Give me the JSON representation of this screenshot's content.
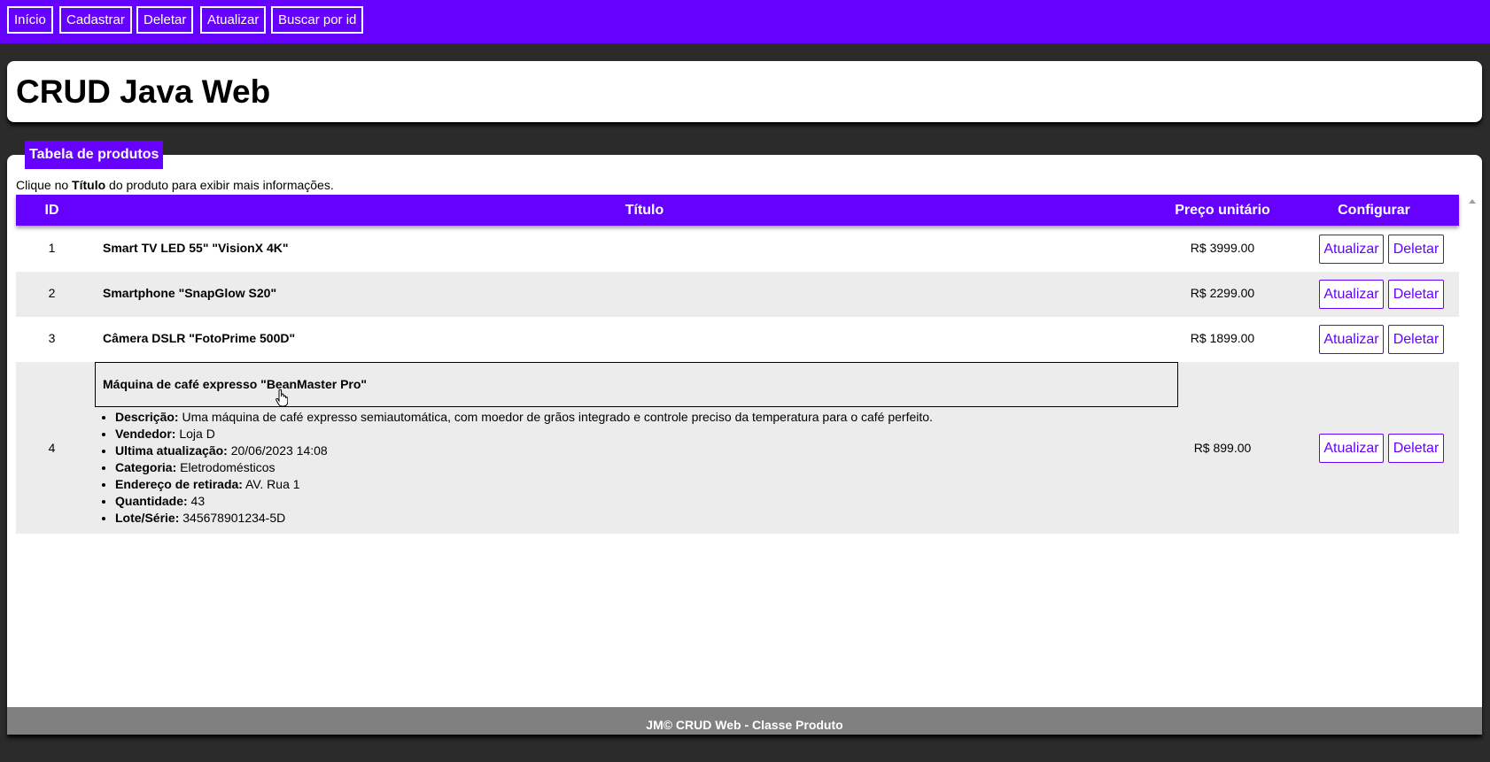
{
  "nav": {
    "items": [
      "Início",
      "Cadastrar",
      "Deletar",
      "Atualizar",
      "Buscar por id"
    ]
  },
  "header": {
    "title": "CRUD Java Web"
  },
  "section": {
    "tag": "Tabela de produtos",
    "hint_prefix": "Clique no ",
    "hint_bold": "Título",
    "hint_suffix": " do produto para exibir mais informações."
  },
  "table": {
    "columns": [
      "ID",
      "Título",
      "Preço unitário",
      "Configurar"
    ],
    "update_label": "Atualizar",
    "delete_label": "Deletar",
    "rows": [
      {
        "id": "1",
        "title": "Smart TV LED 55\" \"VisionX 4K\"",
        "price": "R$ 3999.00"
      },
      {
        "id": "2",
        "title": "Smartphone \"SnapGlow S20\"",
        "price": "R$ 2299.00"
      },
      {
        "id": "3",
        "title": "Câmera DSLR \"FotoPrime 500D\"",
        "price": "R$ 1899.00"
      },
      {
        "id": "4",
        "title": "Máquina de café expresso \"BeanMaster Pro\"",
        "price": "R$ 899.00",
        "details": [
          {
            "label": "Descrição:",
            "value": " Uma máquina de café expresso semiautomática, com moedor de grãos integrado e controle preciso da temperatura para o café perfeito."
          },
          {
            "label": "Vendedor:",
            "value": " Loja D"
          },
          {
            "label": "Ultima atualização:",
            "value": " 20/06/2023 14:08"
          },
          {
            "label": "Categoria:",
            "value": " Eletrodomésticos"
          },
          {
            "label": "Endereço de retirada:",
            "value": " AV. Rua 1"
          },
          {
            "label": "Quantidade:",
            "value": " 43"
          },
          {
            "label": "Lote/Série:",
            "value": " 345678901234-5D"
          }
        ]
      }
    ]
  },
  "footer": {
    "text": "JM© CRUD Web - Classe Produto"
  },
  "colors": {
    "accent": "#6600ff",
    "alt_row": "#ececec",
    "footer": "#808080",
    "background": "#2b2b2b"
  }
}
